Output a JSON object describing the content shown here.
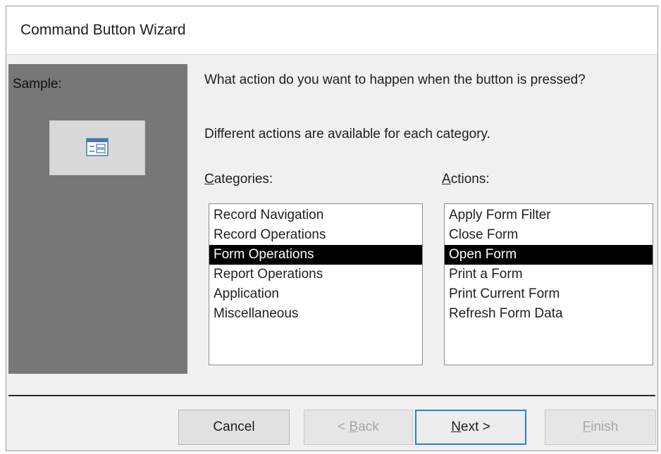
{
  "window": {
    "title": "Command Button Wizard"
  },
  "sample": {
    "label": "Sample:",
    "icon": "form-icon"
  },
  "prompt": "What action do you want to happen when the button is pressed?",
  "info": "Different actions are available for each category.",
  "categories": {
    "label_mnemonic": "C",
    "label_rest": "ategories:",
    "items": [
      "Record Navigation",
      "Record Operations",
      "Form Operations",
      "Report Operations",
      "Application",
      "Miscellaneous"
    ],
    "selected": "Form Operations"
  },
  "actions": {
    "label_mnemonic": "A",
    "label_rest": "ctions:",
    "items": [
      "Apply Form Filter",
      "Close Form",
      "Open Form",
      "Print a Form",
      "Print Current Form",
      "Refresh Form Data"
    ],
    "selected": "Open Form"
  },
  "buttons": {
    "cancel": "Cancel",
    "back_prefix": "< ",
    "back_mnemonic": "B",
    "back_rest": "ack",
    "next_mnemonic": "N",
    "next_rest": "ext >",
    "finish_mnemonic": "F",
    "finish_rest": "inish"
  },
  "colors": {
    "selection": "#000000",
    "sample_panel": "#777777",
    "default_button_border": "#2a7fd4"
  }
}
